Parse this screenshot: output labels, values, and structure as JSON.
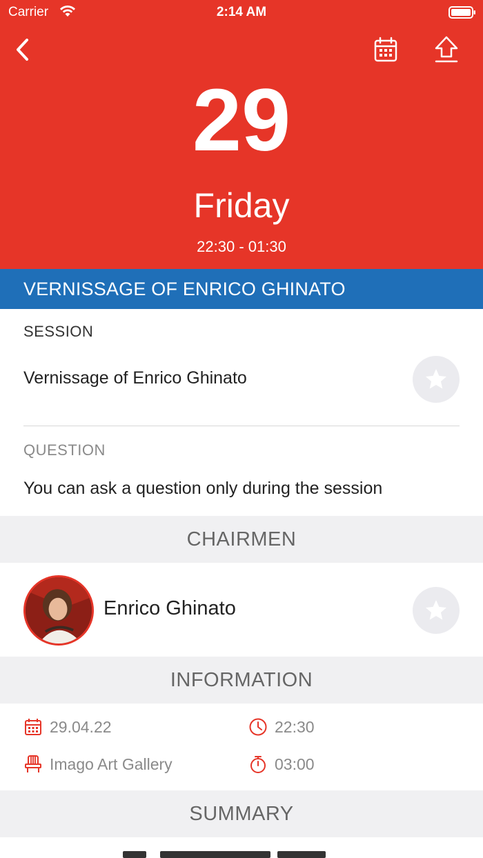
{
  "status_bar": {
    "carrier": "Carrier",
    "time": "2:14 AM"
  },
  "header": {
    "day_number": "29",
    "weekday": "Friday",
    "time_range": "22:30 - 01:30",
    "accent_color": "#e63528",
    "icons": [
      "back-icon",
      "calendar-icon",
      "share-icon"
    ]
  },
  "event_title": "VERNISSAGE OF ENRICO GHINATO",
  "title_bar_color": "#1f6fb8",
  "session": {
    "label": "SESSION",
    "name": "Vernissage of Enrico Ghinato"
  },
  "question": {
    "label": "QUESTION",
    "text": "You can ask a question only during the session"
  },
  "chairmen": {
    "heading": "CHAIRMEN",
    "people": [
      {
        "name": "Enrico Ghinato"
      }
    ]
  },
  "information": {
    "heading": "INFORMATION",
    "date": "29.04.22",
    "start_time": "22:30",
    "location": "Imago Art Gallery",
    "duration": "03:00"
  },
  "summary": {
    "heading": "SUMMARY"
  }
}
